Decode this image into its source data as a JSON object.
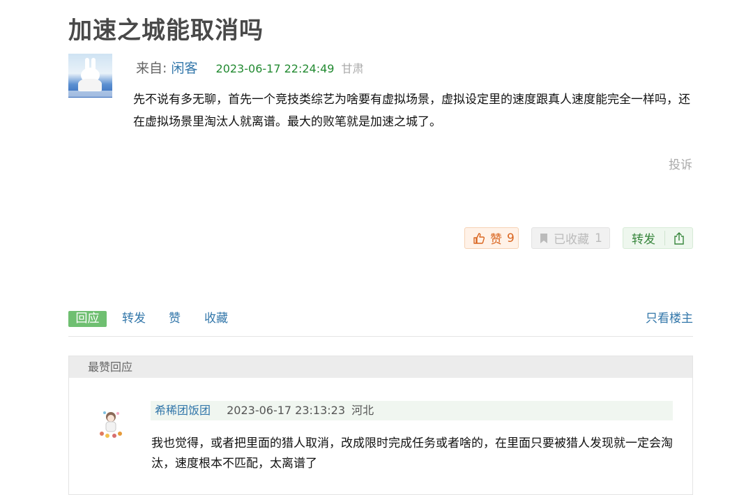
{
  "post": {
    "title": "加速之城能取消吗",
    "from_label": "来自:",
    "author": "闲客",
    "time": "2023-06-17 22:24:49",
    "location": "甘肃",
    "content": "先不说有多无聊，首先一个竞技类综艺为啥要有虚拟场景，虚拟设定里的速度跟真人速度能完全一样吗，还在虚拟场景里淘汰人就离谱。最大的败笔就是加速之城了。",
    "report_label": "投诉"
  },
  "buttons": {
    "like_label": "赞",
    "like_count": "9",
    "fav_label": "已收藏",
    "fav_count": "1",
    "share_label": "转发"
  },
  "actions": {
    "reply": "回应",
    "repost": "转发",
    "like": "赞",
    "collect": "收藏",
    "op_only": "只看楼主"
  },
  "best_replies": {
    "header": "最赞回应",
    "items": [
      {
        "author": "希稀团饭团",
        "time": "2023-06-17 23:13:23",
        "location": "河北",
        "content": "我也觉得，或者把里面的猎人取消，改成限时完成任务或者啥的，在里面只要被猎人发现就一定会淘汰，速度根本不匹配，太离谱了"
      }
    ]
  },
  "icons": {
    "like": "thumbs-up-icon",
    "fav": "bookmark-icon",
    "share": "share-icon"
  },
  "colors": {
    "link": "#3377aa",
    "time_green": "#228a31",
    "reply_btn": "#6fbf71",
    "like_orange": "#d9641e"
  }
}
